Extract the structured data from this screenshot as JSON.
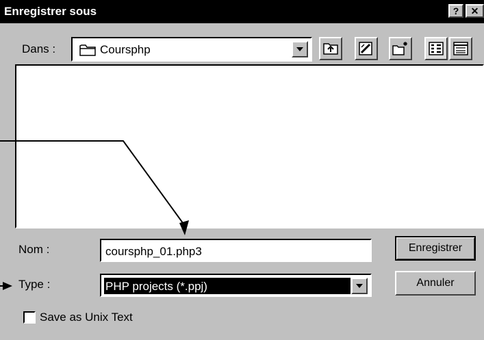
{
  "window": {
    "title": "Enregistrer sous",
    "help_glyph": "?",
    "close_glyph": "✕"
  },
  "look_in": {
    "label": "Dans :",
    "folder": "Coursphp"
  },
  "toolbar": {
    "icons": [
      "up-one-level-icon",
      "desktop-icon",
      "new-folder-icon",
      "list-view-icon",
      "details-view-icon"
    ]
  },
  "filename": {
    "label": "Nom :",
    "value": "coursphp_01.php3"
  },
  "filetype": {
    "label": "Type :",
    "value": "PHP projects (*.ppj)"
  },
  "buttons": {
    "save": "Enregistrer",
    "cancel": "Annuler"
  },
  "unix_checkbox": {
    "label": "Save as Unix Text",
    "checked": false
  },
  "colors": {
    "window_bg": "#c0c0c0",
    "title_bg": "#000000",
    "selection_bg": "#000000"
  }
}
